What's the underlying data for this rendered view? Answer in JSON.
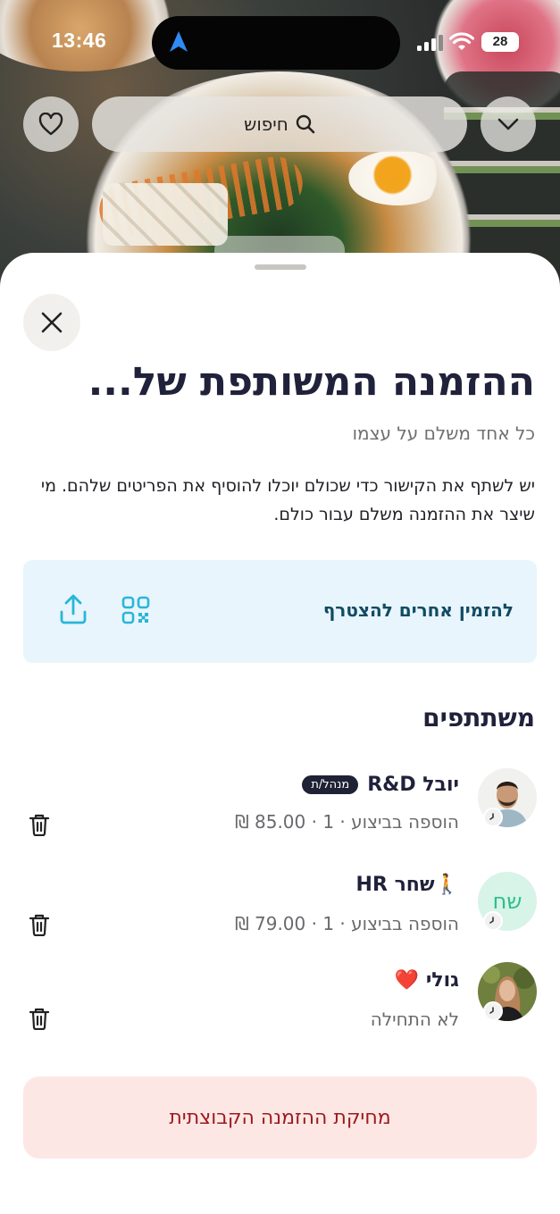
{
  "status_bar": {
    "time": "13:46",
    "battery": "28"
  },
  "header": {
    "search_label": "חיפוש"
  },
  "sheet": {
    "title": "ההזמנה המשותפת של...",
    "subtitle": "כל אחד משלם על עצמו",
    "description": "יש לשתף את הקישור כדי שכולם יוכלו להוסיף את הפריטים שלהם. מי שיצר את ההזמנה משלם עבור כולם.",
    "invite_label": "להזמין אחרים להצטרף",
    "participants_heading": "משתתפים",
    "participants": [
      {
        "name": "יובל R&D",
        "badge": "מנהל/ת",
        "meta": "הוספה בביצוע · 1 · ‏85.00 ₪",
        "avatar": "photo"
      },
      {
        "name": "🚶שחר HR",
        "badge": "",
        "meta": "הוספה בביצוע · 1 · ‏79.00 ₪",
        "avatar_initials": "שח"
      },
      {
        "name": "גולי ❤️",
        "badge": "",
        "meta": "לא התחילה",
        "avatar": "photo"
      }
    ],
    "delete_label": "מחיקת ההזמנה הקבוצתית"
  },
  "colors": {
    "title": "#20213a",
    "invite_bg": "#e8f5fd",
    "invite_icons": "#29b6d8",
    "delete_bg": "#fde7e5",
    "delete_text": "#9b1a1d",
    "initials_bg": "#d8f3e8",
    "initials_text": "#2bbf8a"
  },
  "icons": [
    "heart-icon",
    "search-icon",
    "chevron-down-icon",
    "close-icon",
    "qr-code-icon",
    "share-icon",
    "trash-icon",
    "clock-icon",
    "navigation-arrow-icon",
    "signal-icon",
    "wifi-icon"
  ]
}
